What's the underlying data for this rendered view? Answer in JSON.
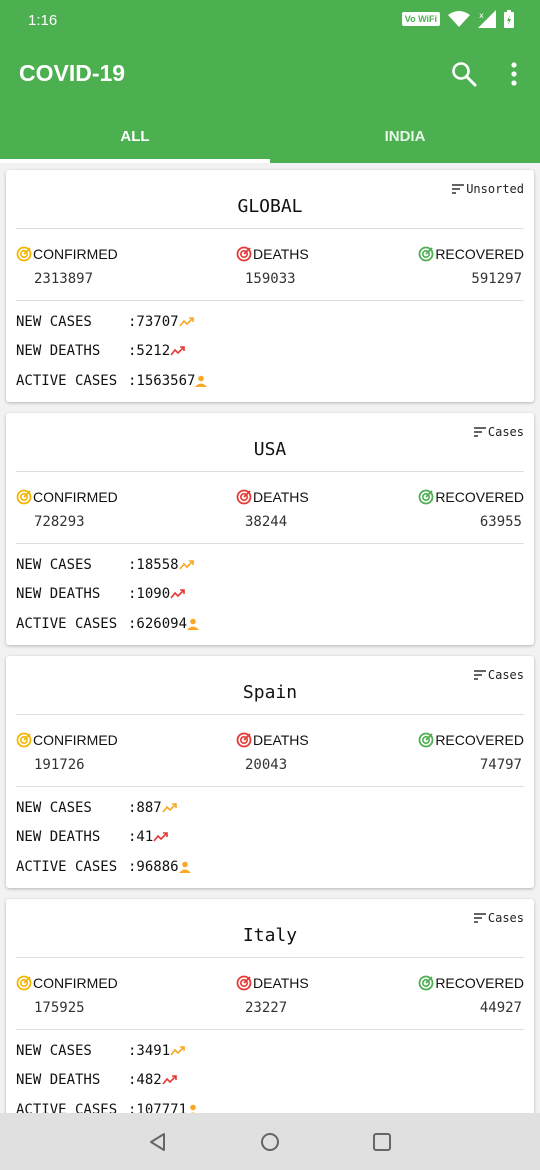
{
  "status_bar": {
    "time": "1:16",
    "vowifi": "Vo WiFi"
  },
  "app": {
    "title": "COVID-19"
  },
  "tabs": [
    {
      "label": "ALL"
    },
    {
      "label": "INDIA"
    }
  ],
  "colors": {
    "accent": "#4caf50",
    "confirmed": "#f4b400",
    "deaths": "#e53935",
    "recovered": "#4caf50",
    "trend_up": "#f9a825",
    "trend_down": "#e53935"
  },
  "labels": {
    "confirmed": "CONFIRMED",
    "deaths": "DEATHS",
    "recovered": "RECOVERED",
    "new_cases": "NEW CASES",
    "new_deaths": "NEW DEATHS",
    "active_cases": "ACTIVE CASES"
  },
  "cards": [
    {
      "sort": "Unsorted",
      "name": "GLOBAL",
      "confirmed": "2313897",
      "deaths": "159033",
      "recovered": "591297",
      "new_cases": ":73707",
      "new_deaths": ":5212",
      "active_cases": ":1563567"
    },
    {
      "sort": "Cases",
      "name": "USA",
      "confirmed": "728293",
      "deaths": "38244",
      "recovered": "63955",
      "new_cases": ":18558",
      "new_deaths": ":1090",
      "active_cases": ":626094"
    },
    {
      "sort": "Cases",
      "name": "Spain",
      "confirmed": "191726",
      "deaths": "20043",
      "recovered": "74797",
      "new_cases": ":887",
      "new_deaths": ":41",
      "active_cases": ":96886"
    },
    {
      "sort": "Cases",
      "name": "Italy",
      "confirmed": "175925",
      "deaths": "23227",
      "recovered": "44927",
      "new_cases": ":3491",
      "new_deaths": ":482",
      "active_cases": ":107771"
    }
  ]
}
